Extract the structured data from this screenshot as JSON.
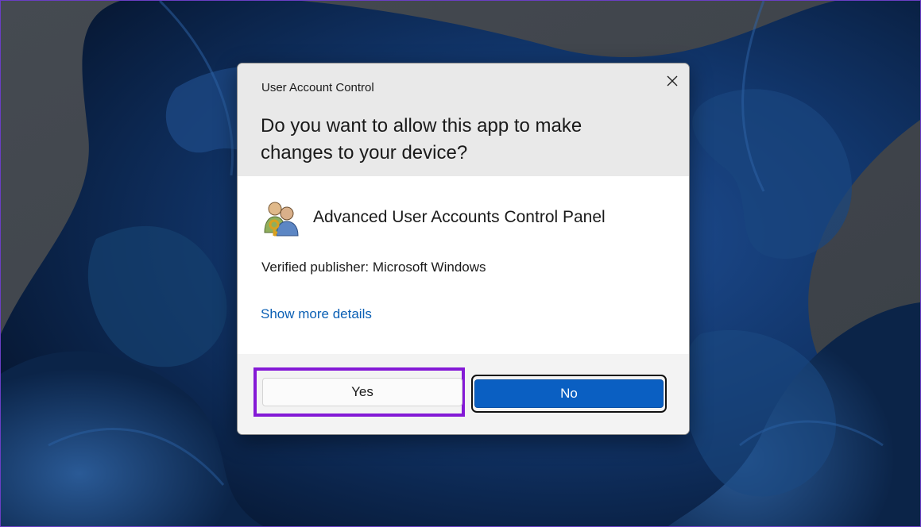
{
  "dialog": {
    "window_title": "User Account Control",
    "question": "Do you want to allow this app to make changes to your device?",
    "app_name": "Advanced User Accounts Control Panel",
    "publisher": "Verified publisher: Microsoft Windows",
    "details_link": "Show more details",
    "yes_label": "Yes",
    "no_label": "No"
  },
  "colors": {
    "header_bg": "#e9e9e9",
    "link": "#0a5fb4",
    "primary_button": "#0a5fc2",
    "highlight": "#8419d6"
  },
  "icons": {
    "close": "close-icon",
    "app": "users-key-icon"
  }
}
